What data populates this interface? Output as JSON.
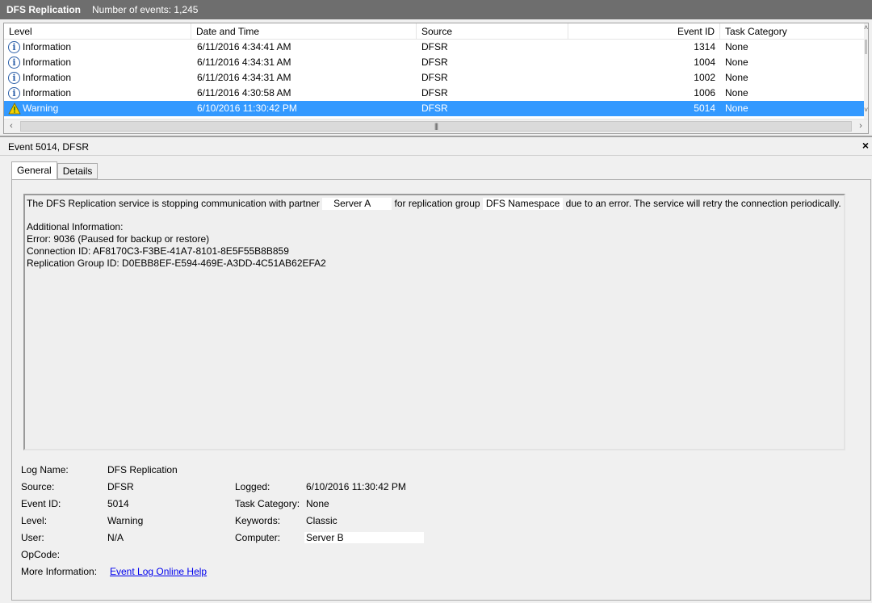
{
  "window": {
    "title": "DFS Replication",
    "event_count": "Number of events: 1,245"
  },
  "columns": {
    "level": "Level",
    "date": "Date and Time",
    "source": "Source",
    "event_id": "Event ID",
    "task": "Task Category"
  },
  "events": [
    {
      "level": "Information",
      "icon": "info-icon",
      "date": "6/11/2016 4:34:41 AM",
      "source": "DFSR",
      "event_id": "1314",
      "task": "None",
      "selected": false
    },
    {
      "level": "Information",
      "icon": "info-icon",
      "date": "6/11/2016 4:34:31 AM",
      "source": "DFSR",
      "event_id": "1004",
      "task": "None",
      "selected": false
    },
    {
      "level": "Information",
      "icon": "info-icon",
      "date": "6/11/2016 4:34:31 AM",
      "source": "DFSR",
      "event_id": "1002",
      "task": "None",
      "selected": false
    },
    {
      "level": "Information",
      "icon": "info-icon",
      "date": "6/11/2016 4:30:58 AM",
      "source": "DFSR",
      "event_id": "1006",
      "task": "None",
      "selected": false
    },
    {
      "level": "Warning",
      "icon": "warning-icon",
      "date": "6/10/2016 11:30:42 PM",
      "source": "DFSR",
      "event_id": "5014",
      "task": "None",
      "selected": true
    }
  ],
  "detail": {
    "header": "Event 5014, DFSR",
    "close": "×",
    "tabs": [
      "General",
      "Details"
    ],
    "message": {
      "part1": "The DFS Replication service is stopping communication with partner",
      "partner": "Server A",
      "part2": "for replication group",
      "group": "DFS Namespace",
      "part3": "due to an error. The service will retry the connection periodically.",
      "additional": "Additional Information:",
      "error": "Error: 9036 (Paused for backup or restore)",
      "connection": "Connection ID: AF8170C3-F3BE-41A7-8101-8E5F55B8B859",
      "group_id": "Replication Group ID: D0EBB8EF-E594-469E-A3DD-4C51AB62EFA2"
    },
    "props": {
      "log_name_label": "Log Name:",
      "log_name": "DFS Replication",
      "source_label": "Source:",
      "source": "DFSR",
      "logged_label": "Logged:",
      "logged": "6/10/2016 11:30:42 PM",
      "event_id_label": "Event ID:",
      "event_id": "5014",
      "task_label": "Task Category:",
      "task": "None",
      "level_label": "Level:",
      "level": "Warning",
      "keywords_label": "Keywords:",
      "keywords": "Classic",
      "user_label": "User:",
      "user": "N/A",
      "computer_label": "Computer:",
      "computer": "Server B",
      "opcode_label": "OpCode:",
      "more_info_label": "More Information:",
      "more_info_link": "Event Log Online Help"
    }
  },
  "colors": {
    "selection": "#3399ff",
    "titlebar": "#6e6e6e",
    "link": "#0000ee"
  }
}
